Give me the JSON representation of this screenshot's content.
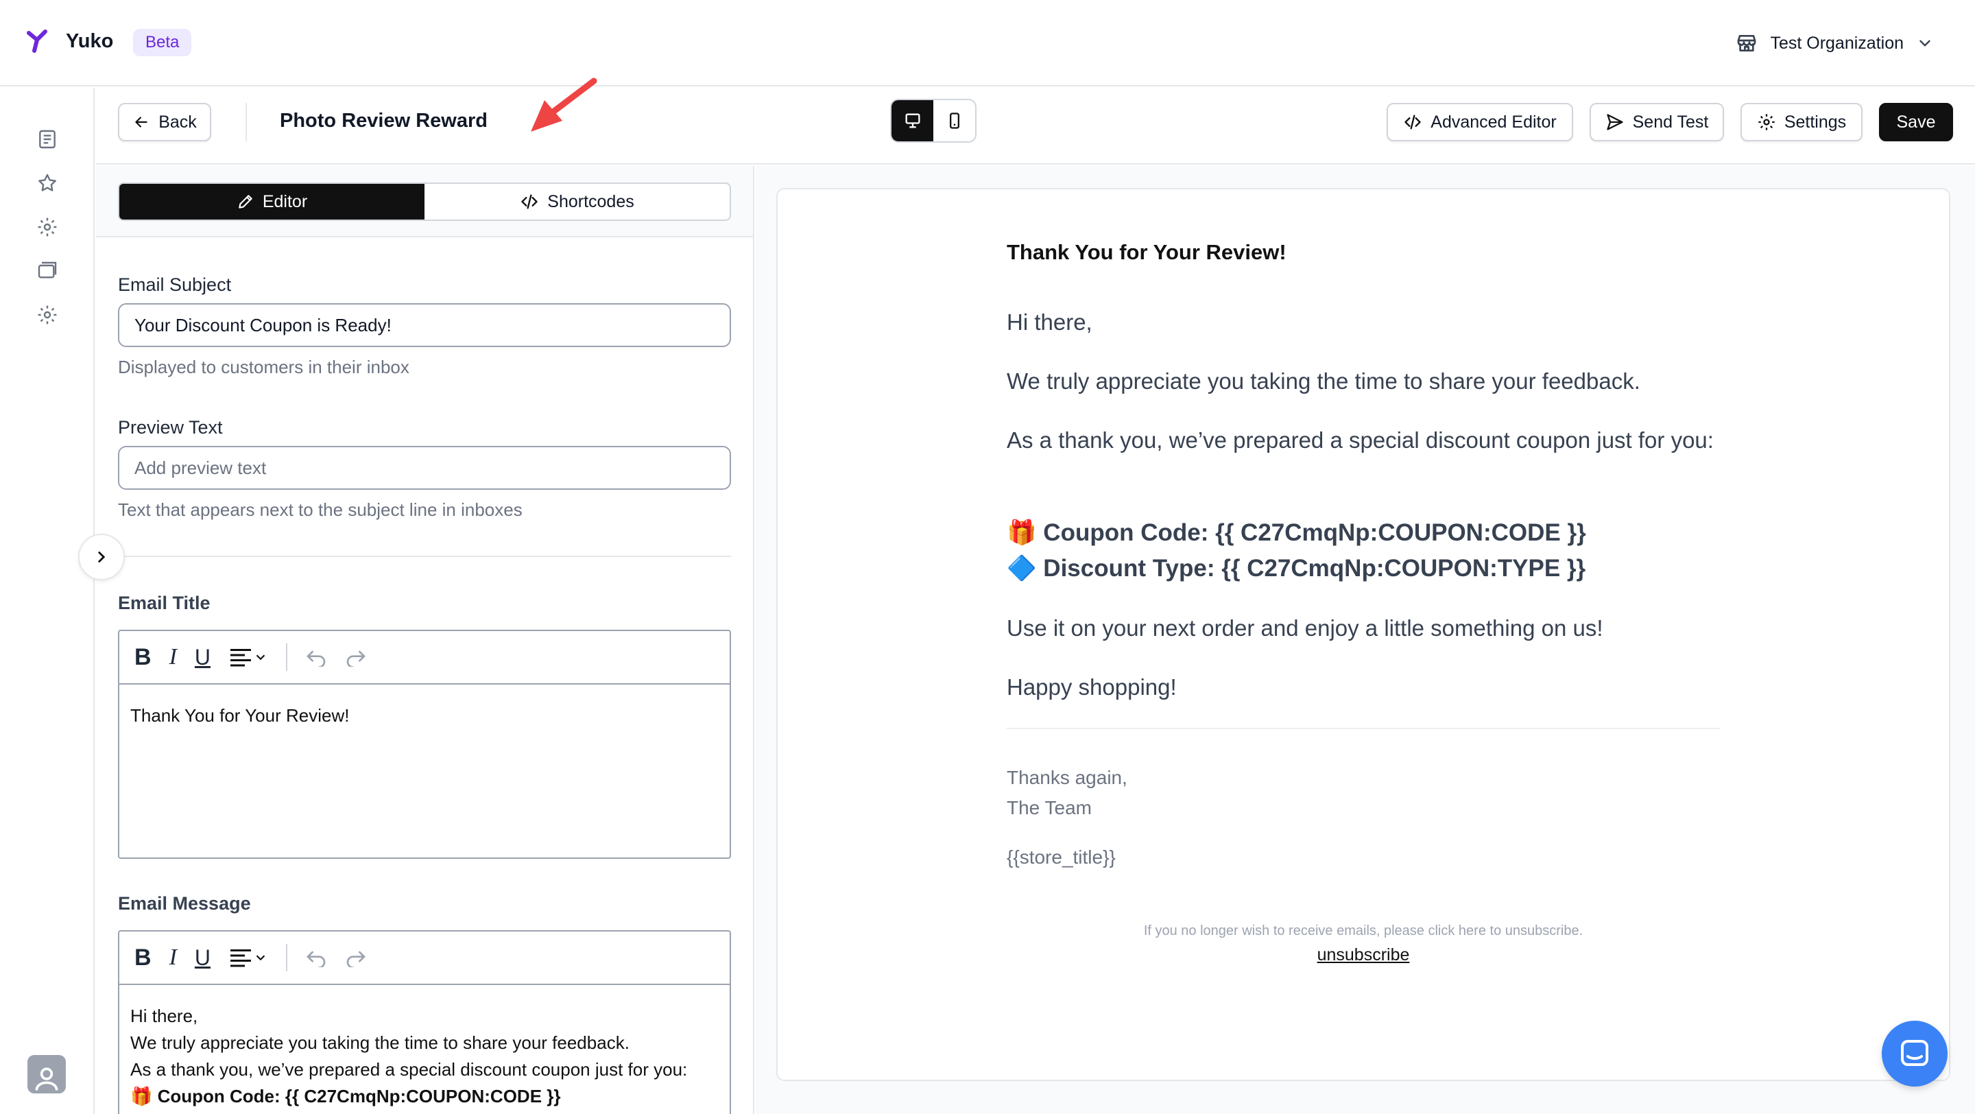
{
  "app": {
    "name": "Yuko",
    "badge": "Beta",
    "organization": "Test Organization"
  },
  "header": {
    "back_label": "Back",
    "title": "Photo Review Reward",
    "advanced_editor_label": "Advanced Editor",
    "send_test_label": "Send Test",
    "settings_label": "Settings",
    "save_label": "Save",
    "device_selected": "desktop"
  },
  "panel": {
    "tabs": [
      {
        "label": "Editor",
        "active": true
      },
      {
        "label": "Shortcodes",
        "active": false
      }
    ],
    "subject": {
      "label": "Email Subject",
      "value": "Your Discount Coupon is Ready!",
      "help": "Displayed to customers in their inbox"
    },
    "preview_text": {
      "label": "Preview Text",
      "placeholder": "Add preview text",
      "help": "Text that appears next to the subject line in inboxes"
    },
    "email_title": {
      "label": "Email Title",
      "content": "Thank You for Your Review!"
    },
    "email_message": {
      "label": "Email Message",
      "lines": [
        "Hi there,",
        "We truly appreciate you taking the time to share your feedback.",
        "As a thank you, we’ve prepared a special discount coupon just for you:",
        "🎁 Coupon Code: {{ C27CmqNp:COUPON:CODE }}"
      ]
    }
  },
  "preview": {
    "title": "Thank You for Your Review!",
    "greeting": "Hi there,",
    "para1": "We truly appreciate you taking the time to share your feedback.",
    "para2": "As a thank you, we’ve prepared a special discount coupon just for you:",
    "coupon_line": "🎁 Coupon Code: {{ C27CmqNp:COUPON:CODE }}",
    "discount_line": "🔷 Discount Type: {{ C27CmqNp:COUPON:TYPE }}",
    "para3": "Use it on your next order and enjoy a little something on us!",
    "para4": "Happy shopping!",
    "signoff1": "Thanks again,",
    "signoff2": "The Team",
    "store": "{{store_title}}",
    "unsubscribe_text": "If you no longer wish to receive emails, please click here to unsubscribe.",
    "unsubscribe_link": "unsubscribe"
  },
  "colors": {
    "accent": "#6d28d9",
    "dark": "#111111",
    "arrow": "#ef4444",
    "chat": "#3b82f6"
  }
}
